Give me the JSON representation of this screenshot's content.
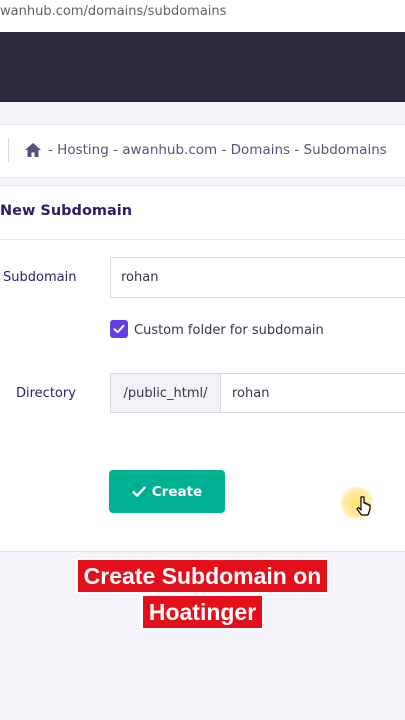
{
  "browser": {
    "url": "wanhub.com/domains/subdomains"
  },
  "breadcrumb": {
    "home_icon": "home-icon",
    "text": "- Hosting - awanhub.com - Domains - Subdomains"
  },
  "card": {
    "title": "New Subdomain"
  },
  "form": {
    "subdomain_label": "Subdomain",
    "subdomain_value": "rohan",
    "custom_folder_label": "Custom folder for subdomain",
    "custom_folder_checked": true,
    "directory_label": "Directory",
    "directory_prefix": "/public_html/",
    "directory_value": "rohan",
    "create_label": "Create"
  },
  "caption": {
    "line1": "Create Subdomain on",
    "line2": "Hoatinger"
  },
  "colors": {
    "accent": "#673de6",
    "button": "#00b090",
    "caption_bg": "#e3101c",
    "nav": "#2d2b40"
  }
}
